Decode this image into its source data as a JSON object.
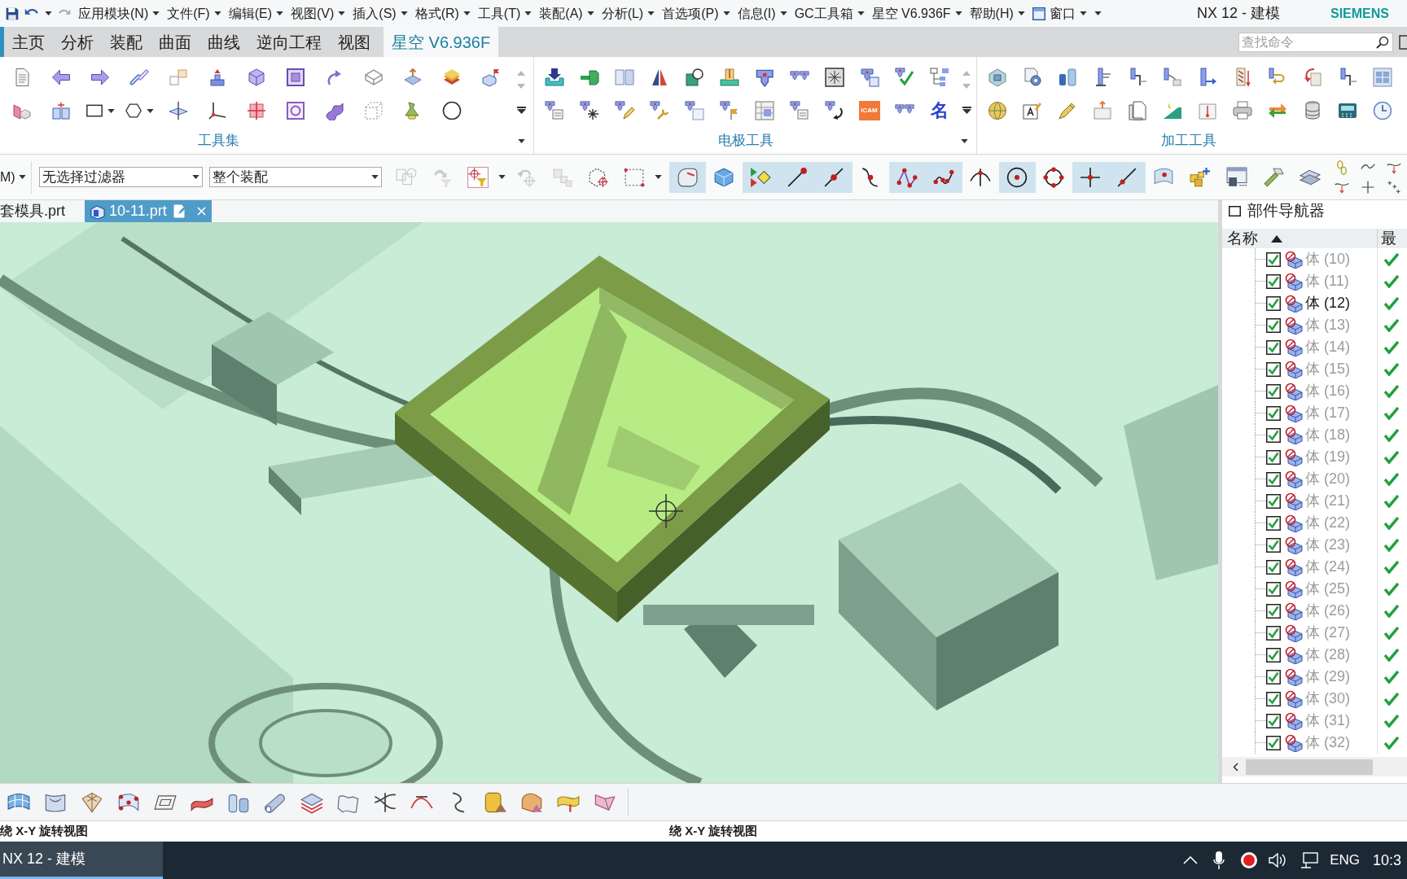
{
  "menu_bar": {
    "items": [
      {
        "label": "应用模块(N)"
      },
      {
        "label": "文件(F)"
      },
      {
        "label": "编辑(E)"
      },
      {
        "label": "视图(V)"
      },
      {
        "label": "插入(S)"
      },
      {
        "label": "格式(R)"
      },
      {
        "label": "工具(T)"
      },
      {
        "label": "装配(A)"
      },
      {
        "label": "分析(L)"
      },
      {
        "label": "首选项(P)"
      },
      {
        "label": "信息(I)"
      },
      {
        "label": "GC工具箱"
      },
      {
        "label": "星空 V6.936F"
      },
      {
        "label": "帮助(H)"
      }
    ],
    "window_menu": {
      "label": "窗口"
    },
    "title": "NX 12 - 建模",
    "brand": "SIEMENS"
  },
  "ribbon": {
    "tabs": [
      {
        "label": "主页",
        "selected": false
      },
      {
        "label": "分析",
        "selected": false
      },
      {
        "label": "装配",
        "selected": false
      },
      {
        "label": "曲面",
        "selected": false
      },
      {
        "label": "曲线",
        "selected": false
      },
      {
        "label": "逆向工程",
        "selected": false
      },
      {
        "label": "视图",
        "selected": false
      },
      {
        "label": "星空 V6.936F",
        "selected": true
      }
    ],
    "search": {
      "placeholder": "查找命令"
    },
    "groups": [
      {
        "label": "工具集"
      },
      {
        "label": "电极工具",
        "text_tools": [
          "ICAM",
          "名"
        ]
      },
      {
        "label": "加工工具"
      }
    ]
  },
  "toolbar": {
    "menu_stub": "M)",
    "filters": [
      {
        "value": "无选择过滤器"
      },
      {
        "value": "整个装配"
      }
    ],
    "selection_tools": [
      {
        "disabled": true
      },
      {
        "disabled": true
      },
      {
        "disabled": false
      },
      {
        "disabled": true
      },
      {
        "disabled": true
      },
      {
        "disabled": false
      },
      {
        "disabled": false
      }
    ],
    "view_tools": [
      {
        "on": true
      },
      {
        "on": false
      }
    ],
    "snap_tools": [
      {
        "on": true
      },
      {
        "on": true
      },
      {
        "on": true
      },
      {
        "on": false
      },
      {
        "on": true
      },
      {
        "on": true
      },
      {
        "on": false
      },
      {
        "on": true
      },
      {
        "on": false
      },
      {
        "on": true
      },
      {
        "on": true
      },
      {
        "on": false
      }
    ]
  },
  "document_tabs": [
    {
      "label": "套模具.prt",
      "selected": false
    },
    {
      "label": "10-11.prt",
      "selected": true
    }
  ],
  "part_navigator": {
    "title": "部件导航器",
    "columns": [
      {
        "label": "名称",
        "sorted": true
      },
      {
        "label": "最",
        "sorted": false
      }
    ],
    "rows": [
      {
        "label": "体 (10)",
        "checked": true,
        "dimmed": true,
        "up_to_date": true
      },
      {
        "label": "体 (11)",
        "checked": true,
        "dimmed": true,
        "up_to_date": true
      },
      {
        "label": "体 (12)",
        "checked": true,
        "dimmed": false,
        "up_to_date": true
      },
      {
        "label": "体 (13)",
        "checked": true,
        "dimmed": true,
        "up_to_date": true
      },
      {
        "label": "体 (14)",
        "checked": true,
        "dimmed": true,
        "up_to_date": true
      },
      {
        "label": "体 (15)",
        "checked": true,
        "dimmed": true,
        "up_to_date": true
      },
      {
        "label": "体 (16)",
        "checked": true,
        "dimmed": true,
        "up_to_date": true
      },
      {
        "label": "体 (17)",
        "checked": true,
        "dimmed": true,
        "up_to_date": true
      },
      {
        "label": "体 (18)",
        "checked": true,
        "dimmed": true,
        "up_to_date": true
      },
      {
        "label": "体 (19)",
        "checked": true,
        "dimmed": true,
        "up_to_date": true
      },
      {
        "label": "体 (20)",
        "checked": true,
        "dimmed": true,
        "up_to_date": true
      },
      {
        "label": "体 (21)",
        "checked": true,
        "dimmed": true,
        "up_to_date": true
      },
      {
        "label": "体 (22)",
        "checked": true,
        "dimmed": true,
        "up_to_date": true
      },
      {
        "label": "体 (23)",
        "checked": true,
        "dimmed": true,
        "up_to_date": true
      },
      {
        "label": "体 (24)",
        "checked": true,
        "dimmed": true,
        "up_to_date": true
      },
      {
        "label": "体 (25)",
        "checked": true,
        "dimmed": true,
        "up_to_date": true
      },
      {
        "label": "体 (26)",
        "checked": true,
        "dimmed": true,
        "up_to_date": true
      },
      {
        "label": "体 (27)",
        "checked": true,
        "dimmed": true,
        "up_to_date": true
      },
      {
        "label": "体 (28)",
        "checked": true,
        "dimmed": true,
        "up_to_date": true
      },
      {
        "label": "体 (29)",
        "checked": true,
        "dimmed": true,
        "up_to_date": true
      },
      {
        "label": "体 (30)",
        "checked": true,
        "dimmed": true,
        "up_to_date": true
      },
      {
        "label": "体 (31)",
        "checked": true,
        "dimmed": true,
        "up_to_date": true
      },
      {
        "label": "体 (32)",
        "checked": true,
        "dimmed": true,
        "up_to_date": true
      }
    ]
  },
  "status_bar": {
    "left": "绕 X-Y 旋转视图",
    "center": "绕 X-Y 旋转视图"
  },
  "taskbar": {
    "app": {
      "label": "NX 12 - 建模",
      "active": true
    },
    "language": "ENG",
    "time": "10:3"
  }
}
